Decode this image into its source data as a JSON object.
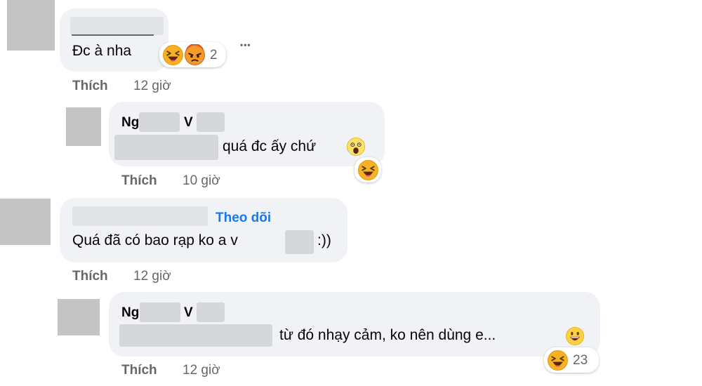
{
  "comments": [
    {
      "text": "Đc à nha",
      "like_label": "Thích",
      "time": "12 giờ",
      "reaction_count": "2",
      "more_label": "•••"
    },
    {
      "name_start": "Ng",
      "name_mid": "V",
      "text": "quá đc ấy chứ",
      "like_label": "Thích",
      "time": "10 giờ"
    },
    {
      "follow_label": "Theo dõi",
      "text_start": "Quá đã có bao rạp ko a v",
      "text_end": ":))",
      "like_label": "Thích",
      "time": "12 giờ"
    },
    {
      "name_start": "Ng",
      "name_mid": "V",
      "text": "từ đó nhạy cảm, ko nên dùng e...",
      "like_label": "Thích",
      "time": "12 giờ",
      "reaction_count": "23"
    }
  ],
  "icons": {
    "haha": "laughing-face-icon",
    "angry": "angry-face-icon",
    "wow": "surprised-face-icon",
    "smile": "grinning-face-icon"
  },
  "colors": {
    "bubble": "#f0f2f5",
    "link_blue": "#1877f2",
    "meta_gray": "#65676b",
    "haha_yellow": "#f7b125",
    "angry_orange": "#e9710f"
  }
}
